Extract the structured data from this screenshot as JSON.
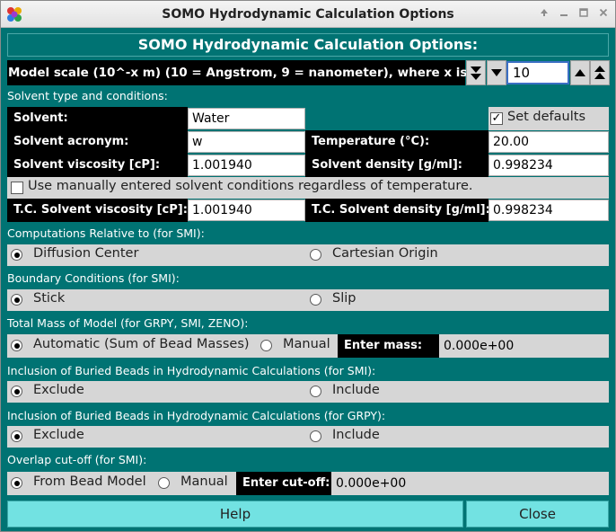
{
  "window": {
    "title": "SOMO Hydrodynamic Calculation Options",
    "controls": [
      "up-icon",
      "minimize-icon",
      "maximize-icon",
      "close-icon"
    ]
  },
  "header": "SOMO Hydrodynamic Calculation Options:",
  "model_scale": {
    "label": "Model scale (10^-x m) (10 = Angstrom, 9 = nanometer), where x is :",
    "value": "10"
  },
  "solvent": {
    "section_label": "Solvent type and conditions:",
    "solvent_label": "Solvent:",
    "solvent_value": "Water",
    "set_defaults_label": "Set defaults",
    "set_defaults_checked": true,
    "acronym_label": "Solvent acronym:",
    "acronym_value": "w",
    "temperature_label": "Temperature (°C):",
    "temperature_value": "20.00",
    "viscosity_label": "Solvent viscosity [cP]:",
    "viscosity_value": "1.001940",
    "density_label": "Solvent density [g/ml]:",
    "density_value": "0.998234",
    "manual_label": "Use manually entered solvent conditions regardless of temperature.",
    "manual_checked": false,
    "tc_viscosity_label": "T.C. Solvent viscosity [cP]:",
    "tc_viscosity_value": "1.001940",
    "tc_density_label": "T.C. Solvent density [g/ml]:",
    "tc_density_value": "0.998234"
  },
  "computations": {
    "section_label": "Computations Relative to (for SMI):",
    "options": [
      "Diffusion Center",
      "Cartesian Origin"
    ],
    "selected": "Diffusion Center"
  },
  "boundary": {
    "section_label": "Boundary Conditions (for SMI):",
    "options": [
      "Stick",
      "Slip"
    ],
    "selected": "Stick"
  },
  "mass": {
    "section_label": "Total Mass of Model (for GRPY, SMI, ZENO):",
    "options": [
      "Automatic (Sum of Bead Masses)",
      "Manual"
    ],
    "selected": "Automatic (Sum of Bead Masses)",
    "enter_label": "Enter mass:",
    "enter_value": "0.000e+00"
  },
  "buried_smi": {
    "section_label": "Inclusion of Buried Beads in Hydrodynamic Calculations (for SMI):",
    "options": [
      "Exclude",
      "Include"
    ],
    "selected": "Exclude"
  },
  "buried_grpy": {
    "section_label": "Inclusion of Buried Beads in Hydrodynamic Calculations (for GRPY):",
    "options": [
      "Exclude",
      "Include"
    ],
    "selected": "Exclude"
  },
  "overlap": {
    "section_label": "Overlap cut-off (for SMI):",
    "options": [
      "From Bead Model",
      "Manual"
    ],
    "selected": "From Bead Model",
    "enter_label": "Enter cut-off:",
    "enter_value": "0.000e+00"
  },
  "buttons": {
    "help": "Help",
    "close": "Close"
  },
  "colors": {
    "panel": "#007373",
    "button": "#72e2e2",
    "label_bg": "#000000",
    "focus": "#3b6fc4"
  }
}
